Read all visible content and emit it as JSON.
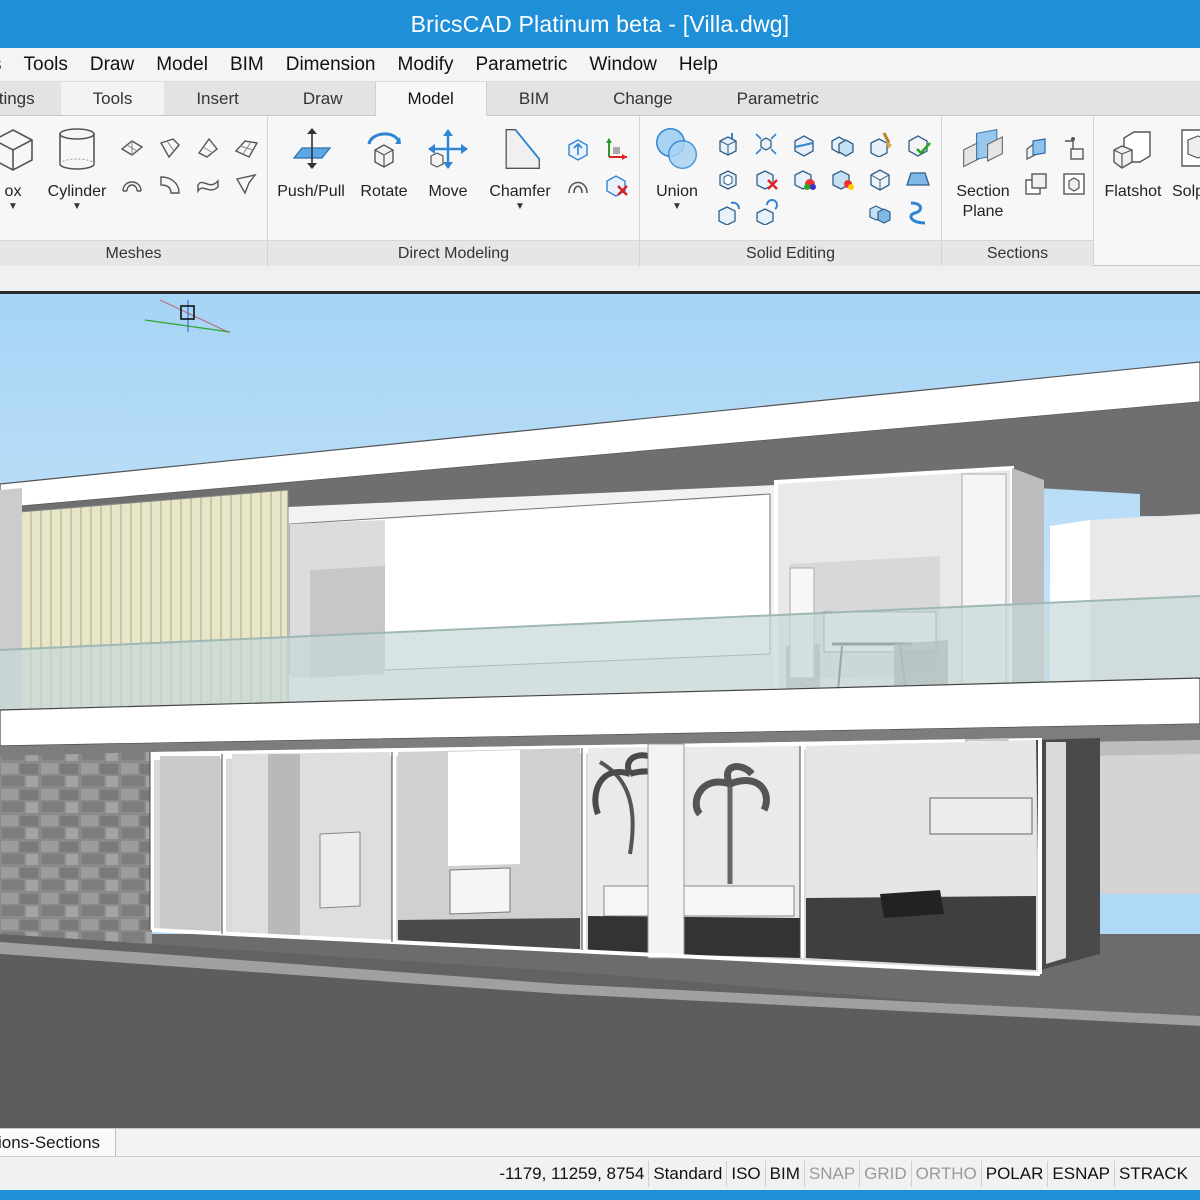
{
  "window": {
    "title": "BricsCAD Platinum beta - [Villa.dwg]"
  },
  "menu": {
    "items": [
      {
        "id": "cut",
        "label": "s"
      },
      {
        "id": "tools",
        "label": "Tools"
      },
      {
        "id": "draw",
        "label": "Draw"
      },
      {
        "id": "model",
        "label": "Model"
      },
      {
        "id": "bim",
        "label": "BIM"
      },
      {
        "id": "dimension",
        "label": "Dimension"
      },
      {
        "id": "modify",
        "label": "Modify"
      },
      {
        "id": "parametric",
        "label": "Parametric"
      },
      {
        "id": "window",
        "label": "Window"
      },
      {
        "id": "help",
        "label": "Help"
      }
    ]
  },
  "ribbon_tabs": [
    {
      "label": "ttings",
      "active": false
    },
    {
      "label": "Tools",
      "active": false
    },
    {
      "label": "Insert",
      "active": false
    },
    {
      "label": "Draw",
      "active": false
    },
    {
      "label": "Model",
      "active": true
    },
    {
      "label": "BIM",
      "active": false
    },
    {
      "label": "Change",
      "active": false
    },
    {
      "label": "Parametric",
      "active": false
    }
  ],
  "ribbon": {
    "meshes": {
      "label": "Meshes",
      "box_label": "ox",
      "cylinder_label": "Cylinder"
    },
    "direct_modeling": {
      "label": "Direct Modeling",
      "pushpull_label": "Push/Pull",
      "rotate_label": "Rotate",
      "move_label": "Move",
      "chamfer_label": "Chamfer"
    },
    "solid_editing": {
      "label": "Solid Editing",
      "union_label": "Union"
    },
    "sections": {
      "label": "Sections",
      "section_plane_label": "Section\nPlane"
    },
    "flatshot": {
      "flatshot_label": "Flatshot",
      "solprof_label": "Solp"
    }
  },
  "layout_tab": {
    "label": "ions-Sections"
  },
  "status": {
    "coords": "-1179, 11259, 8754",
    "items": [
      {
        "label": "Standard",
        "on": true
      },
      {
        "label": "ISO",
        "on": true
      },
      {
        "label": "BIM",
        "on": true
      },
      {
        "label": "SNAP",
        "on": false
      },
      {
        "label": "GRID",
        "on": false
      },
      {
        "label": "ORTHO",
        "on": false
      },
      {
        "label": "POLAR",
        "on": true
      },
      {
        "label": "ESNAP",
        "on": true
      },
      {
        "label": "STRACK",
        "on": true
      }
    ]
  },
  "colors": {
    "title_bar": "#1f8fd8",
    "sky": "#b0d9f6",
    "ribbon": "#f7f7f7"
  }
}
